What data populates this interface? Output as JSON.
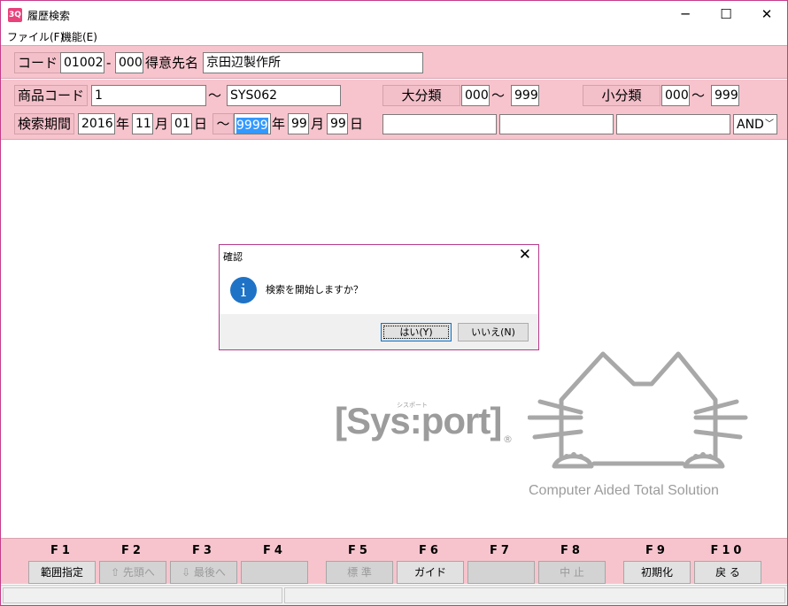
{
  "window": {
    "title": "履歴検索",
    "icon": "app-icon",
    "minimize": "─",
    "maximize": "☐",
    "close": "✕"
  },
  "menu": {
    "items": [
      "ファイル(F)",
      "機能(E)"
    ]
  },
  "header": {
    "code_label": "コード",
    "code1": "01002",
    "code_sep": "-",
    "code2": "000",
    "customer_label": "得意先名",
    "customer_name": "京田辺製作所"
  },
  "search": {
    "product_code_label": "商品コード",
    "product_from": "1",
    "tilde": "～",
    "product_to": "SYS062",
    "major_class_label": "大分類",
    "major_from": "000",
    "major_to": "999",
    "minor_class_label": "小分類",
    "minor_from": "000",
    "minor_to": "999",
    "period_label": "検索期間",
    "from_year": "2016",
    "year_unit": "年",
    "from_month": "11",
    "month_unit": "月",
    "from_day": "01",
    "day_unit": "日",
    "to_year": "9999",
    "to_month": "99",
    "to_day": "99",
    "free1": "",
    "free2": "",
    "free3": "",
    "logic_op": "AND"
  },
  "dialog": {
    "title": "確認",
    "message": "検索を開始しますか？",
    "yes": "はい(Y)",
    "no": "いいえ(N)"
  },
  "logo": {
    "brand": "[Sys:port]",
    "brand_ruby": "シスポート",
    "registered": "®",
    "tagline": "Computer Aided Total Solution"
  },
  "function_keys": [
    {
      "key": "F1",
      "label": "範囲指定",
      "enabled": true
    },
    {
      "key": "F2",
      "label": "⇧ 先頭へ",
      "enabled": false
    },
    {
      "key": "F3",
      "label": "⇩ 最後へ",
      "enabled": false
    },
    {
      "key": "F4",
      "label": "",
      "enabled": false
    },
    {
      "key": "F5",
      "label": "標 準",
      "enabled": false
    },
    {
      "key": "F6",
      "label": "ガイド",
      "enabled": true
    },
    {
      "key": "F7",
      "label": "",
      "enabled": false
    },
    {
      "key": "F8",
      "label": "中 止",
      "enabled": false
    },
    {
      "key": "F9",
      "label": "初期化",
      "enabled": true
    },
    {
      "key": "F10",
      "label": "戻 る",
      "enabled": true
    }
  ]
}
